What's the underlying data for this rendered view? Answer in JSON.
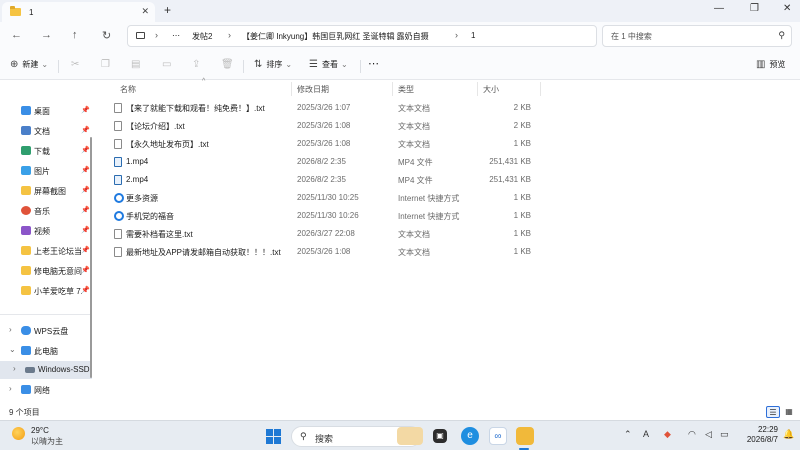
{
  "window": {
    "tab_title": "1",
    "tab_close": "✕",
    "new_tab": "+",
    "controls": [
      "—",
      "❐",
      "✕"
    ]
  },
  "nav": {
    "back": "←",
    "forward": "→",
    "up": "↑",
    "refresh": "↻",
    "more": "⋯",
    "breadcrumb": [
      "发帖2",
      "【姜仁卿 Inkyung】韩国巨乳网红 圣诞特辑 露奶自摄",
      "1"
    ],
    "separator": "›",
    "search_placeholder": "在 1 中搜索"
  },
  "toolbar": {
    "new_label": "新建",
    "sort_label": "排序",
    "view_label": "查看",
    "more": "⋯",
    "preview_label": "预览"
  },
  "sidebar": {
    "quick_access": [
      {
        "label": "桌面",
        "icon": "desktop-icon",
        "color": "#3a8ee6"
      },
      {
        "label": "文档",
        "icon": "documents-icon",
        "color": "#4a7fc9"
      },
      {
        "label": "下载",
        "icon": "downloads-icon",
        "color": "#2f9e6e"
      },
      {
        "label": "图片",
        "icon": "pictures-icon",
        "color": "#3aa0e8"
      },
      {
        "label": "屏幕截图",
        "icon": "folder-icon",
        "color": "#f5c342"
      },
      {
        "label": "音乐",
        "icon": "music-icon",
        "color": "#e0533a"
      },
      {
        "label": "视频",
        "icon": "videos-icon",
        "color": "#8b55c9"
      },
      {
        "label": "上老王论坛当",
        "icon": "folder-icon",
        "color": "#f5c342"
      },
      {
        "label": "修电脑无意间",
        "icon": "folder-icon",
        "color": "#f5c342"
      },
      {
        "label": "小羊爱吃草 7.",
        "icon": "folder-icon",
        "color": "#f5c342"
      }
    ],
    "locations": [
      {
        "label": "WPS云盘",
        "icon": "cloud-icon",
        "color": "#3a8ee6"
      },
      {
        "label": "此电脑",
        "icon": "this-pc-icon",
        "color": "#3a8ee6"
      },
      {
        "label": "Windows-SSD",
        "icon": "drive-icon",
        "color": "#6b7a8c"
      },
      {
        "label": "网络",
        "icon": "network-icon",
        "color": "#3a8ee6"
      }
    ]
  },
  "columns": {
    "name": "名称",
    "date": "修改日期",
    "type": "类型",
    "size": "大小"
  },
  "files": [
    {
      "name": "【来了就能下载和观看！纯免费！】.txt",
      "date": "2025/3/26 1:07",
      "type": "文本文档",
      "size": "2 KB",
      "kind": "txt"
    },
    {
      "name": "【论坛介绍】.txt",
      "date": "2025/3/26 1:08",
      "type": "文本文档",
      "size": "2 KB",
      "kind": "txt"
    },
    {
      "name": "【永久地址发布页】.txt",
      "date": "2025/3/26 1:08",
      "type": "文本文档",
      "size": "1 KB",
      "kind": "txt"
    },
    {
      "name": "1.mp4",
      "date": "2026/8/2 2:35",
      "type": "MP4 文件",
      "size": "251,431 KB",
      "kind": "mp4"
    },
    {
      "name": "2.mp4",
      "date": "2026/8/2 2:35",
      "type": "MP4 文件",
      "size": "251,431 KB",
      "kind": "mp4"
    },
    {
      "name": "更多资源",
      "date": "2025/11/30 10:25",
      "type": "Internet 快捷方式",
      "size": "1 KB",
      "kind": "url"
    },
    {
      "name": "手机党的福音",
      "date": "2025/11/30 10:26",
      "type": "Internet 快捷方式",
      "size": "1 KB",
      "kind": "url"
    },
    {
      "name": "需要补档看这里.txt",
      "date": "2026/3/27 22:08",
      "type": "文本文档",
      "size": "1 KB",
      "kind": "txt"
    },
    {
      "name": "最新地址及APP请发邮箱自动获取！！！.txt",
      "date": "2025/3/26 1:08",
      "type": "文本文档",
      "size": "1 KB",
      "kind": "txt"
    }
  ],
  "status": {
    "item_count": "9 个项目"
  },
  "taskbar": {
    "temperature": "29°C",
    "weather": "以晴为主",
    "search_label": "搜索",
    "time": "22:29",
    "date": "2026/8/7"
  }
}
